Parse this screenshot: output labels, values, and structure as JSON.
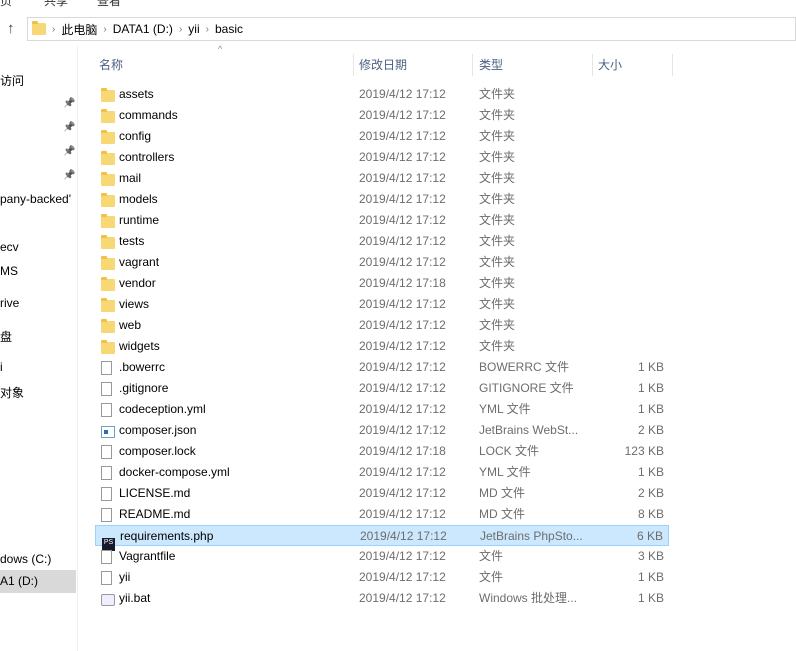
{
  "ribbon": {
    "tabs": [
      "页",
      "共享",
      "查看"
    ]
  },
  "address": {
    "path": [
      "此电脑",
      "DATA1 (D:)",
      "yii",
      "basic"
    ]
  },
  "nav": {
    "items": [
      {
        "label": "访问",
        "pinned": false
      },
      {
        "label": "",
        "pinned": true
      },
      {
        "label": "",
        "pinned": true
      },
      {
        "label": "",
        "pinned": true
      },
      {
        "label": "",
        "pinned": true
      },
      {
        "label": "pany-backed'"
      },
      {
        "label": "ecv"
      },
      {
        "label": "MS"
      },
      {
        "label": "rive"
      },
      {
        "label": "盘"
      },
      {
        "label": "i"
      },
      {
        "label": "对象"
      },
      {
        "label": "dows (C:)"
      },
      {
        "label": "A1 (D:)",
        "selected": true
      }
    ]
  },
  "columns": {
    "name": "名称",
    "date": "修改日期",
    "type": "类型",
    "size": "大小"
  },
  "files": [
    {
      "name": "assets",
      "date": "2019/4/12 17:12",
      "type": "文件夹",
      "size": "",
      "icon": "folder"
    },
    {
      "name": "commands",
      "date": "2019/4/12 17:12",
      "type": "文件夹",
      "size": "",
      "icon": "folder"
    },
    {
      "name": "config",
      "date": "2019/4/12 17:12",
      "type": "文件夹",
      "size": "",
      "icon": "folder"
    },
    {
      "name": "controllers",
      "date": "2019/4/12 17:12",
      "type": "文件夹",
      "size": "",
      "icon": "folder"
    },
    {
      "name": "mail",
      "date": "2019/4/12 17:12",
      "type": "文件夹",
      "size": "",
      "icon": "folder"
    },
    {
      "name": "models",
      "date": "2019/4/12 17:12",
      "type": "文件夹",
      "size": "",
      "icon": "folder"
    },
    {
      "name": "runtime",
      "date": "2019/4/12 17:12",
      "type": "文件夹",
      "size": "",
      "icon": "folder"
    },
    {
      "name": "tests",
      "date": "2019/4/12 17:12",
      "type": "文件夹",
      "size": "",
      "icon": "folder"
    },
    {
      "name": "vagrant",
      "date": "2019/4/12 17:12",
      "type": "文件夹",
      "size": "",
      "icon": "folder"
    },
    {
      "name": "vendor",
      "date": "2019/4/12 17:18",
      "type": "文件夹",
      "size": "",
      "icon": "folder"
    },
    {
      "name": "views",
      "date": "2019/4/12 17:12",
      "type": "文件夹",
      "size": "",
      "icon": "folder"
    },
    {
      "name": "web",
      "date": "2019/4/12 17:12",
      "type": "文件夹",
      "size": "",
      "icon": "folder"
    },
    {
      "name": "widgets",
      "date": "2019/4/12 17:12",
      "type": "文件夹",
      "size": "",
      "icon": "folder"
    },
    {
      "name": ".bowerrc",
      "date": "2019/4/12 17:12",
      "type": "BOWERRC 文件",
      "size": "1 KB",
      "icon": "file"
    },
    {
      "name": ".gitignore",
      "date": "2019/4/12 17:12",
      "type": "GITIGNORE 文件",
      "size": "1 KB",
      "icon": "file"
    },
    {
      "name": "codeception.yml",
      "date": "2019/4/12 17:12",
      "type": "YML 文件",
      "size": "1 KB",
      "icon": "file"
    },
    {
      "name": "composer.json",
      "date": "2019/4/12 17:12",
      "type": "JetBrains WebSt...",
      "size": "2 KB",
      "icon": "json"
    },
    {
      "name": "composer.lock",
      "date": "2019/4/12 17:18",
      "type": "LOCK 文件",
      "size": "123 KB",
      "icon": "file"
    },
    {
      "name": "docker-compose.yml",
      "date": "2019/4/12 17:12",
      "type": "YML 文件",
      "size": "1 KB",
      "icon": "file"
    },
    {
      "name": "LICENSE.md",
      "date": "2019/4/12 17:12",
      "type": "MD 文件",
      "size": "2 KB",
      "icon": "file"
    },
    {
      "name": "README.md",
      "date": "2019/4/12 17:12",
      "type": "MD 文件",
      "size": "8 KB",
      "icon": "file"
    },
    {
      "name": "requirements.php",
      "date": "2019/4/12 17:12",
      "type": "JetBrains PhpSto...",
      "size": "6 KB",
      "icon": "phpstorm",
      "selected": true
    },
    {
      "name": "Vagrantfile",
      "date": "2019/4/12 17:12",
      "type": "文件",
      "size": "3 KB",
      "icon": "file"
    },
    {
      "name": "yii",
      "date": "2019/4/12 17:12",
      "type": "文件",
      "size": "1 KB",
      "icon": "file"
    },
    {
      "name": "yii.bat",
      "date": "2019/4/12 17:12",
      "type": "Windows 批处理...",
      "size": "1 KB",
      "icon": "bat"
    }
  ],
  "colors": {
    "selection": "#cce8ff",
    "header_text": "#4d6082",
    "folder": "#f8d775"
  }
}
